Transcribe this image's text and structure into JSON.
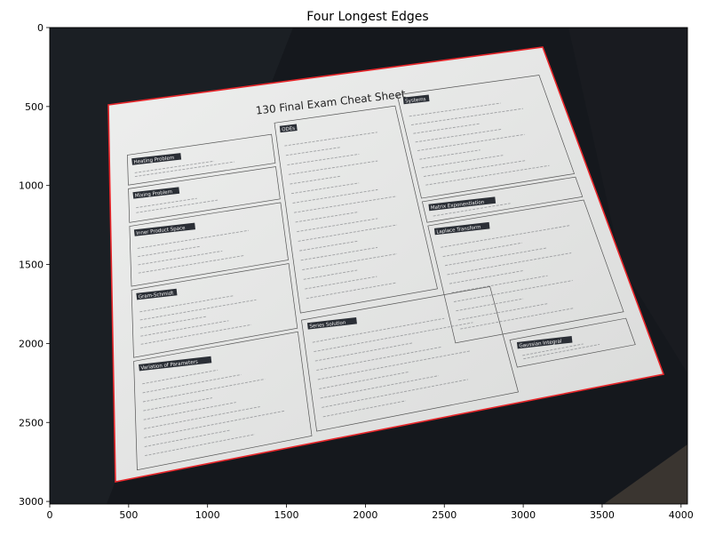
{
  "figure": {
    "title": "Four Longest Edges",
    "x_ticks": [
      "0",
      "500",
      "1000",
      "1500",
      "2000",
      "2500",
      "3000",
      "3500",
      "4000"
    ],
    "y_ticks": [
      "0",
      "500",
      "1000",
      "1500",
      "2000",
      "2500",
      "3000"
    ],
    "colors": {
      "edge": "#e8262a",
      "background": "#15181d",
      "paper": "#e6e7e6"
    }
  },
  "sheet": {
    "title": "130 Final Exam Cheat Sheet",
    "boxes": [
      "Heating Problem",
      "Mixing Problem",
      "Inner Product Space",
      "Gram-Schmidt",
      "Variation of Parameters",
      "ODEs",
      "Systems",
      "Matrix Exponentiation",
      "Laplace Transform",
      "Series Solution",
      "Gaussian Integral"
    ]
  }
}
